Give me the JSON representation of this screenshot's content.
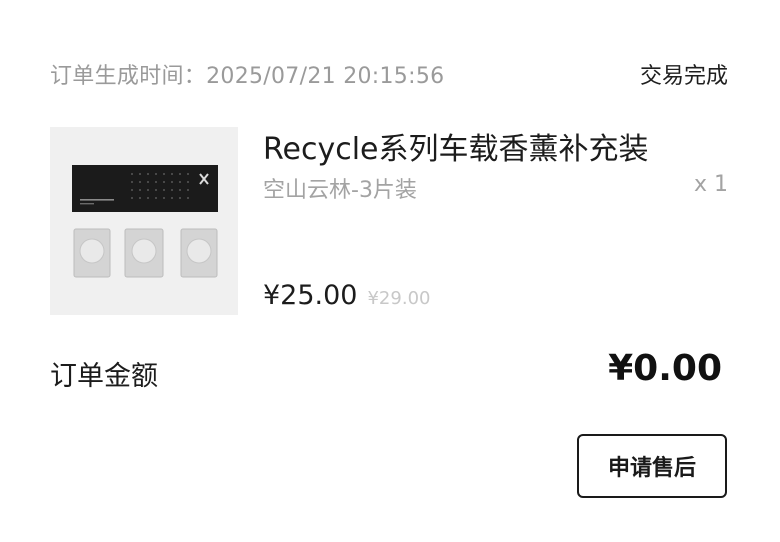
{
  "order": {
    "time_label": "订单生成时间：",
    "time_value": "2025/07/21 20:15:56",
    "status": "交易完成"
  },
  "product": {
    "title": "Recycle系列车载香薰补充装",
    "variant": "空山云林-3片装",
    "quantity": "x 1",
    "price": "¥25.00",
    "original_price": "¥29.00"
  },
  "total": {
    "label": "订单金额",
    "amount": "¥0.00"
  },
  "actions": {
    "after_sale_label": "申请售后"
  }
}
